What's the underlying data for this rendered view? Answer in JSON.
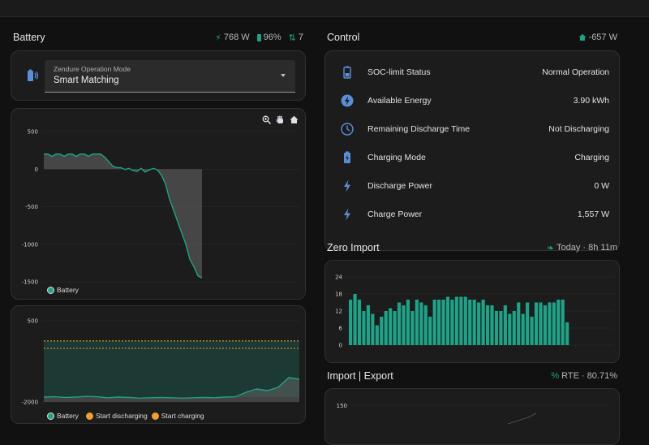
{
  "battery": {
    "title": "Battery",
    "power": "768 W",
    "soc": "96%",
    "count": "7",
    "mode_label": "Zendure Operation Mode",
    "mode_value": "Smart Matching"
  },
  "chart1": {
    "legend": "Battery"
  },
  "chart2": {
    "legend_battery": "Battery",
    "legend_discharge": "Start discharging",
    "legend_charge": "Start charging"
  },
  "control": {
    "title": "Control",
    "meta": "-657 W",
    "rows": [
      {
        "label": "SOC-limit Status",
        "value": "Normal Operation",
        "icon": "battery-level-icon"
      },
      {
        "label": "Available Energy",
        "value": "3.90 kWh",
        "icon": "lightning-circle-icon"
      },
      {
        "label": "Remaining Discharge Time",
        "value": "Not Discharging",
        "icon": "clock-icon"
      },
      {
        "label": "Charging Mode",
        "value": "Charging",
        "icon": "battery-charging-icon"
      },
      {
        "label": "Discharge Power",
        "value": "0 W",
        "icon": "flash-icon"
      },
      {
        "label": "Charge Power",
        "value": "1,557 W",
        "icon": "flash-icon"
      }
    ]
  },
  "zero_import": {
    "title": "Zero Import",
    "meta": "Today · 8h 11m"
  },
  "import_export": {
    "title": "Import | Export",
    "meta": "RTE · 80.71%",
    "tick": "150"
  },
  "colors": {
    "accent": "#1fa287",
    "orange": "#f0a030",
    "icon_blue": "#5b8ed6"
  },
  "chart_data": [
    {
      "type": "area",
      "series": [
        {
          "name": "Battery",
          "values": [
            200,
            200,
            170,
            200,
            200,
            170,
            200,
            200,
            170,
            200,
            200,
            170,
            200,
            200,
            200,
            160,
            100,
            40,
            20,
            20,
            -5,
            10,
            -20,
            -30,
            10,
            -40,
            -10,
            10,
            -10,
            -80,
            -200,
            -400,
            -550,
            -700,
            -850,
            -1000,
            -1200,
            -1300,
            -1420,
            -1450
          ]
        }
      ],
      "ylim": [
        -1500,
        500
      ],
      "yticks": [
        "500",
        "0",
        "-500",
        "-1000",
        "-1500"
      ]
    },
    {
      "type": "line",
      "series": [
        {
          "name": "Battery",
          "values": [
            -1850,
            -1840,
            -1860,
            -1850,
            -1830,
            -1840,
            -1870,
            -1850,
            -1860,
            -1880,
            -1870,
            -1860,
            -1870,
            -1880,
            -1870,
            -1860,
            -1870,
            -1850,
            -1840,
            -1700,
            -1600,
            -1650,
            -1550,
            -1250,
            -1300
          ]
        },
        {
          "name": "Start discharging",
          "values": [
            -120,
            -120
          ]
        },
        {
          "name": "Start charging",
          "values": [
            -350,
            -350
          ]
        }
      ],
      "ylim": [
        -2000,
        700
      ],
      "yticks": [
        "500",
        "-2000"
      ]
    },
    {
      "type": "bar",
      "series": [
        {
          "name": "Zero Import",
          "values": [
            16,
            18,
            16,
            12,
            14,
            11,
            7,
            10,
            12,
            13,
            12,
            15,
            14,
            16,
            12,
            16,
            15,
            14,
            10,
            16,
            16,
            16,
            17,
            16,
            17,
            17,
            17,
            16,
            16,
            15,
            16,
            14,
            14,
            12,
            12,
            14,
            11,
            12,
            15,
            11,
            15,
            10,
            15,
            15,
            14,
            15,
            15,
            16,
            16,
            8
          ]
        }
      ],
      "ylim": [
        0,
        24
      ],
      "yticks": [
        "24",
        "18",
        "12",
        "6",
        "0"
      ]
    }
  ]
}
